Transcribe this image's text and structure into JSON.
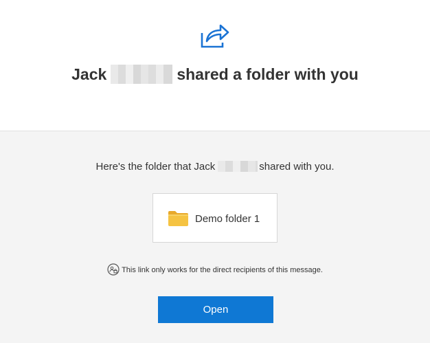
{
  "header": {
    "title_prefix": "Jack",
    "title_suffix": "shared a folder with you",
    "icon": "share-arrow-icon"
  },
  "message": {
    "prefix": "Here's the folder that Jack",
    "suffix": "shared with you."
  },
  "folder": {
    "name": "Demo folder 1",
    "icon": "folder-icon"
  },
  "notice": {
    "text": "This link only works for the direct recipients of this message.",
    "icon": "people-lock-icon"
  },
  "actions": {
    "open_label": "Open"
  },
  "colors": {
    "accent": "#0f78d4",
    "folder": "#f5c342",
    "background": "#f4f4f4"
  }
}
